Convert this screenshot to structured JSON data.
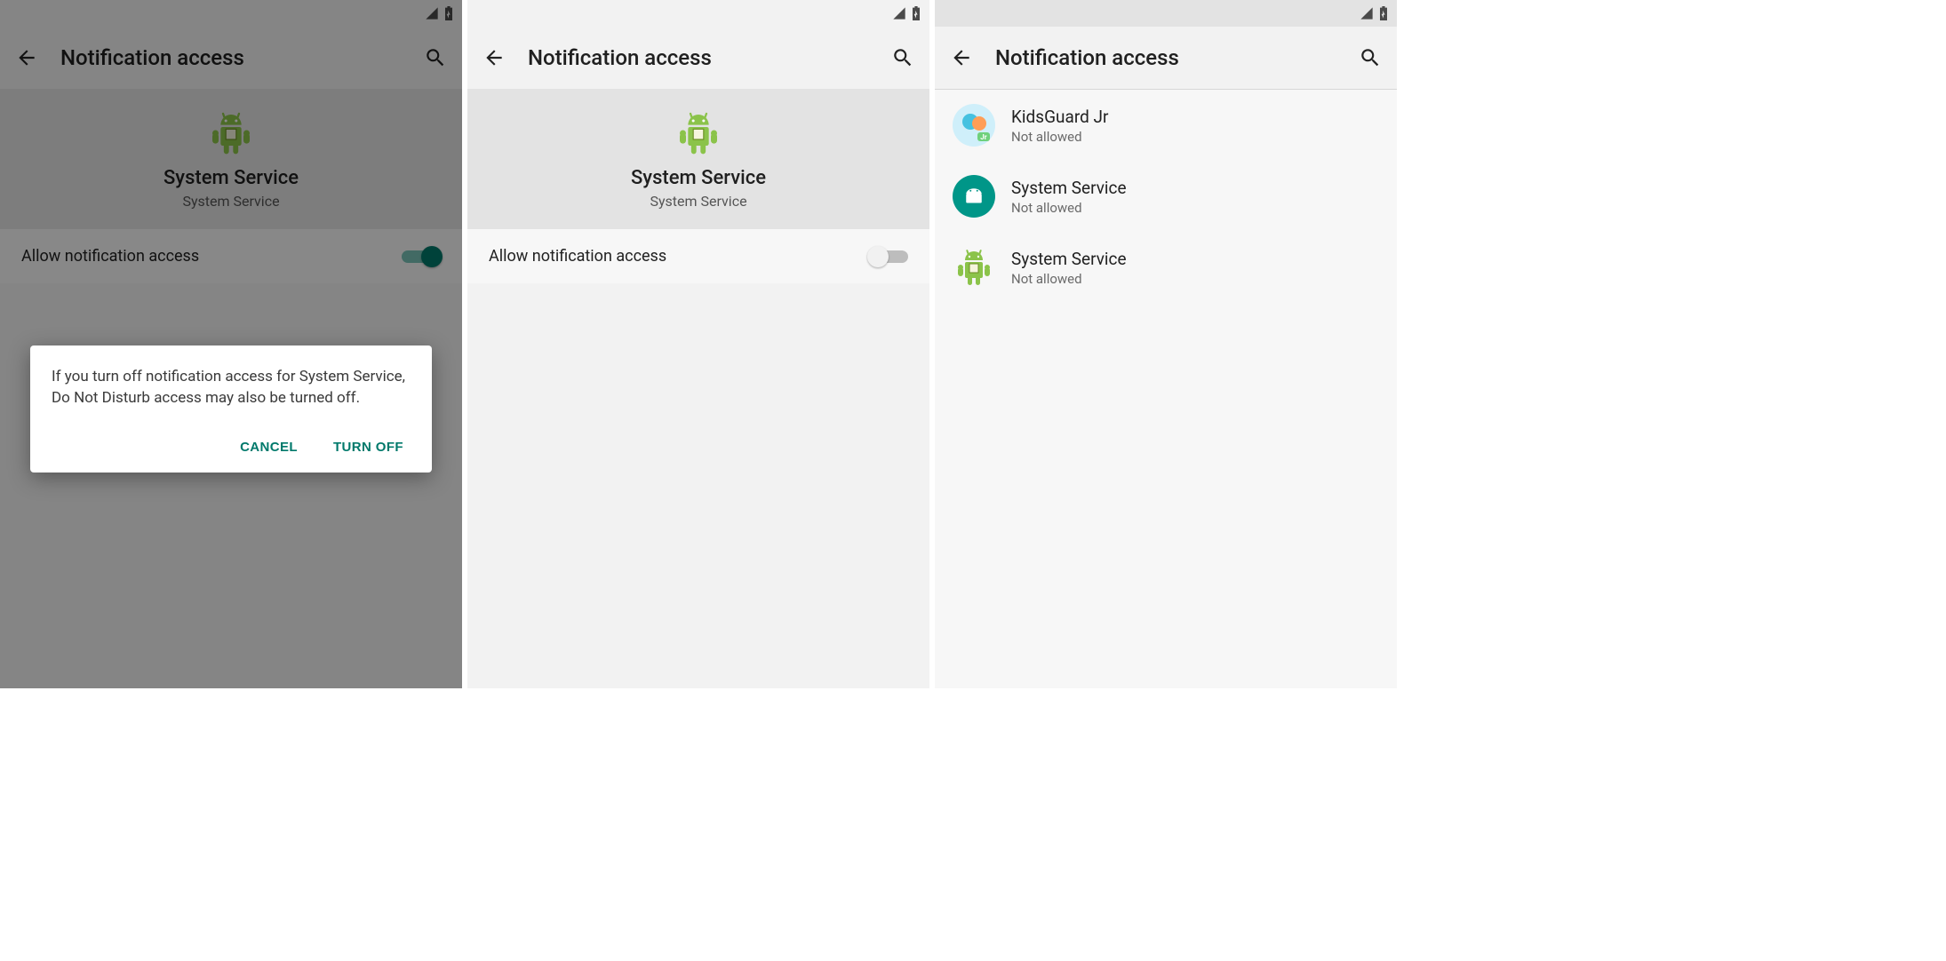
{
  "status": {
    "signal_icon": "signal",
    "battery_icon": "battery-charging"
  },
  "screen1": {
    "title": "Notification access",
    "hero": {
      "name": "System Service",
      "sub": "System Service"
    },
    "toggle": {
      "label": "Allow notification access",
      "on": true
    },
    "dialog": {
      "body": "If you turn off notification access for System Service, Do Not Disturb access may also be turned off.",
      "cancel": "CANCEL",
      "confirm": "TURN OFF"
    }
  },
  "screen2": {
    "title": "Notification access",
    "hero": {
      "name": "System Service",
      "sub": "System Service"
    },
    "toggle": {
      "label": "Allow notification access",
      "on": false
    }
  },
  "screen3": {
    "title": "Notification access",
    "items": [
      {
        "name": "KidsGuard Jr",
        "status": "Not allowed",
        "icon": "kidsguard"
      },
      {
        "name": "System Service",
        "status": "Not allowed",
        "icon": "android-circle"
      },
      {
        "name": "System Service",
        "status": "Not allowed",
        "icon": "android-green"
      }
    ]
  }
}
